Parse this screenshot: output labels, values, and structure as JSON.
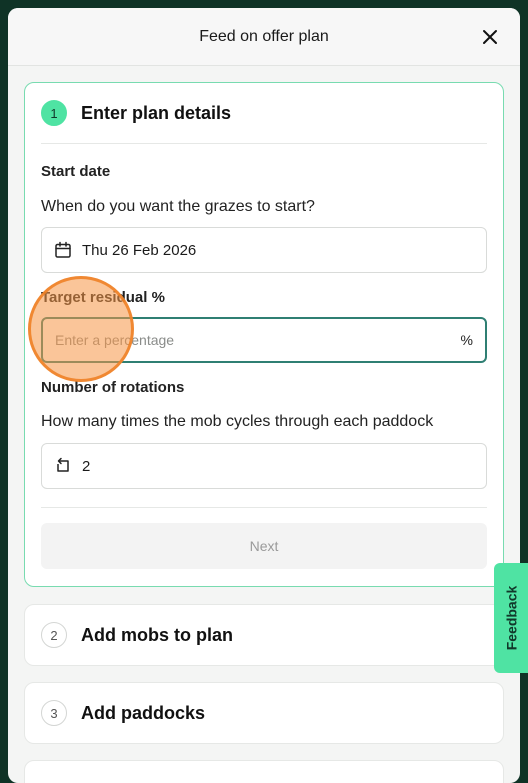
{
  "header": {
    "title": "Feed on offer plan"
  },
  "steps": [
    {
      "number": "1",
      "title": "Enter plan details"
    },
    {
      "number": "2",
      "title": "Add mobs to plan"
    },
    {
      "number": "3",
      "title": "Add paddocks"
    }
  ],
  "start_date": {
    "label": "Start date",
    "question": "When do you want the grazes to start?",
    "value": "Thu 26 Feb 2026",
    "icon": "calendar-icon"
  },
  "target_residual": {
    "label": "Target residual %",
    "placeholder": "Enter a percentage",
    "suffix": "%"
  },
  "rotations": {
    "label": "Number of rotations",
    "question": "How many times the mob cycles through each paddock",
    "value": "2",
    "icon": "rotate-icon"
  },
  "next_label": "Next",
  "feedback_label": "Feedback",
  "colors": {
    "accent": "#4fe3a3",
    "focus_border": "#2f7f73",
    "background": "#0f3326"
  }
}
